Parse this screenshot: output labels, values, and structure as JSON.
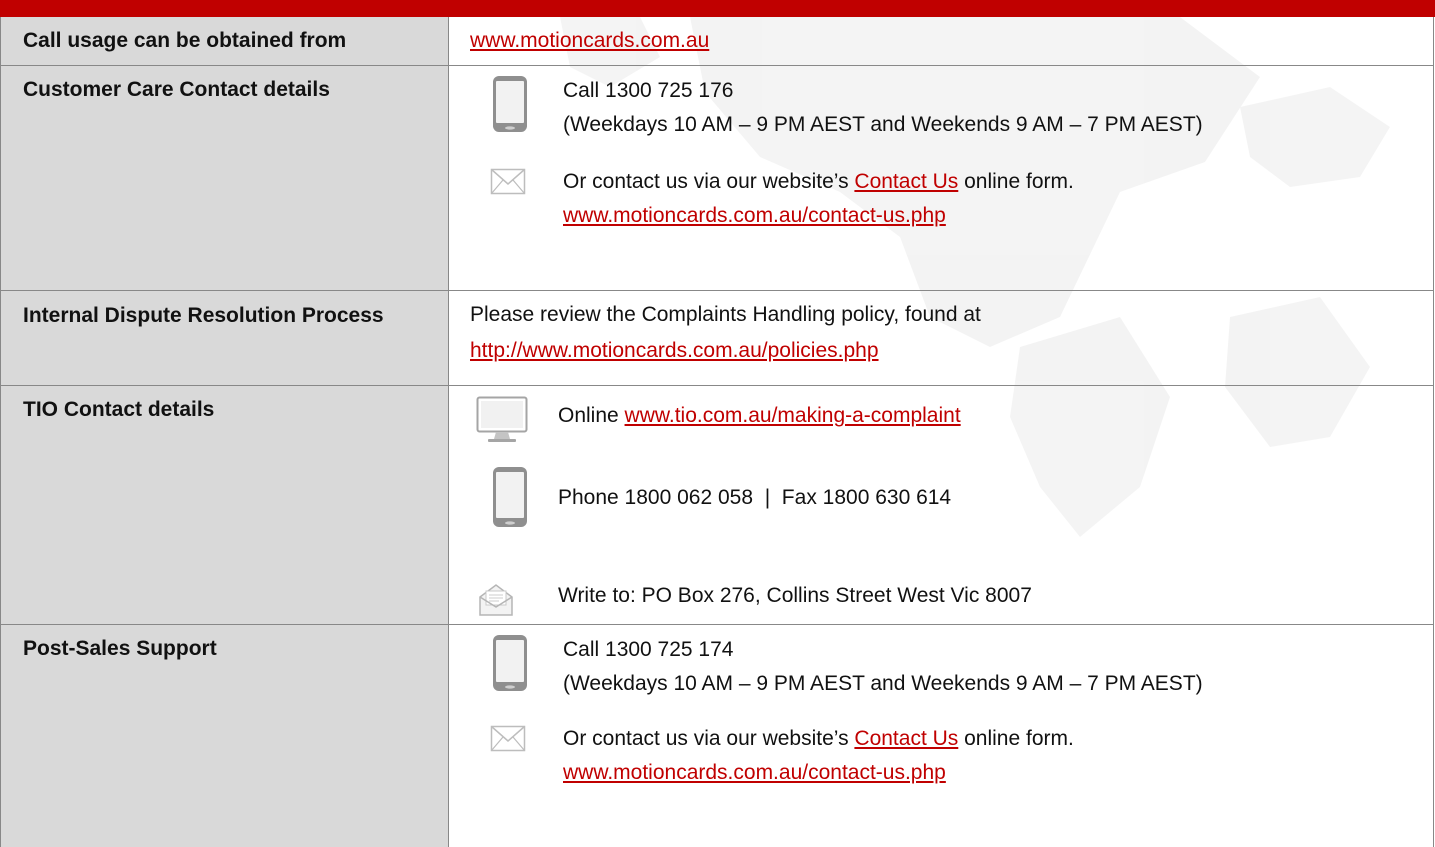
{
  "rows": [
    {
      "label": "Call usage can be obtained from",
      "link": "www.motioncards.com.au"
    },
    {
      "label": "Customer Care Contact details",
      "phone_line": "Call 1300 725 176",
      "hours_line": "(Weekdays 10 AM – 9 PM AEST and Weekends 9 AM – 7 PM AEST)",
      "contact_before": "Or contact us via our website’s ",
      "contact_link": "Contact Us",
      "contact_after": " online form.",
      "contact_url": "www.motioncards.com.au/contact-us.php"
    },
    {
      "label": "Internal Dispute Resolution Process",
      "text": "Please review the Complaints Handling policy, found at",
      "link": "http://www.motioncards.com.au/policies.php"
    },
    {
      "label": "TIO Contact details",
      "online_prefix": "Online ",
      "online_link": "www.tio.com.au/making-a-complaint",
      "phone_fax": "Phone 1800 062 058  |  Fax 1800 630 614",
      "write_to": "Write to: PO Box 276, Collins Street West Vic 8007"
    },
    {
      "label": "Post-Sales Support",
      "phone_line": "Call 1300 725 174",
      "hours_line": "(Weekdays 10 AM – 9 PM AEST and Weekends 9 AM – 7 PM AEST)",
      "contact_before": "Or contact us via our website’s ",
      "contact_link": "Contact Us",
      "contact_after": " online form.",
      "contact_url": "www.motioncards.com.au/contact-us.php"
    }
  ],
  "colors": {
    "header_bar": "#c00000",
    "label_background": "#d9d9d9",
    "link": "#c00000",
    "border": "#888888"
  }
}
